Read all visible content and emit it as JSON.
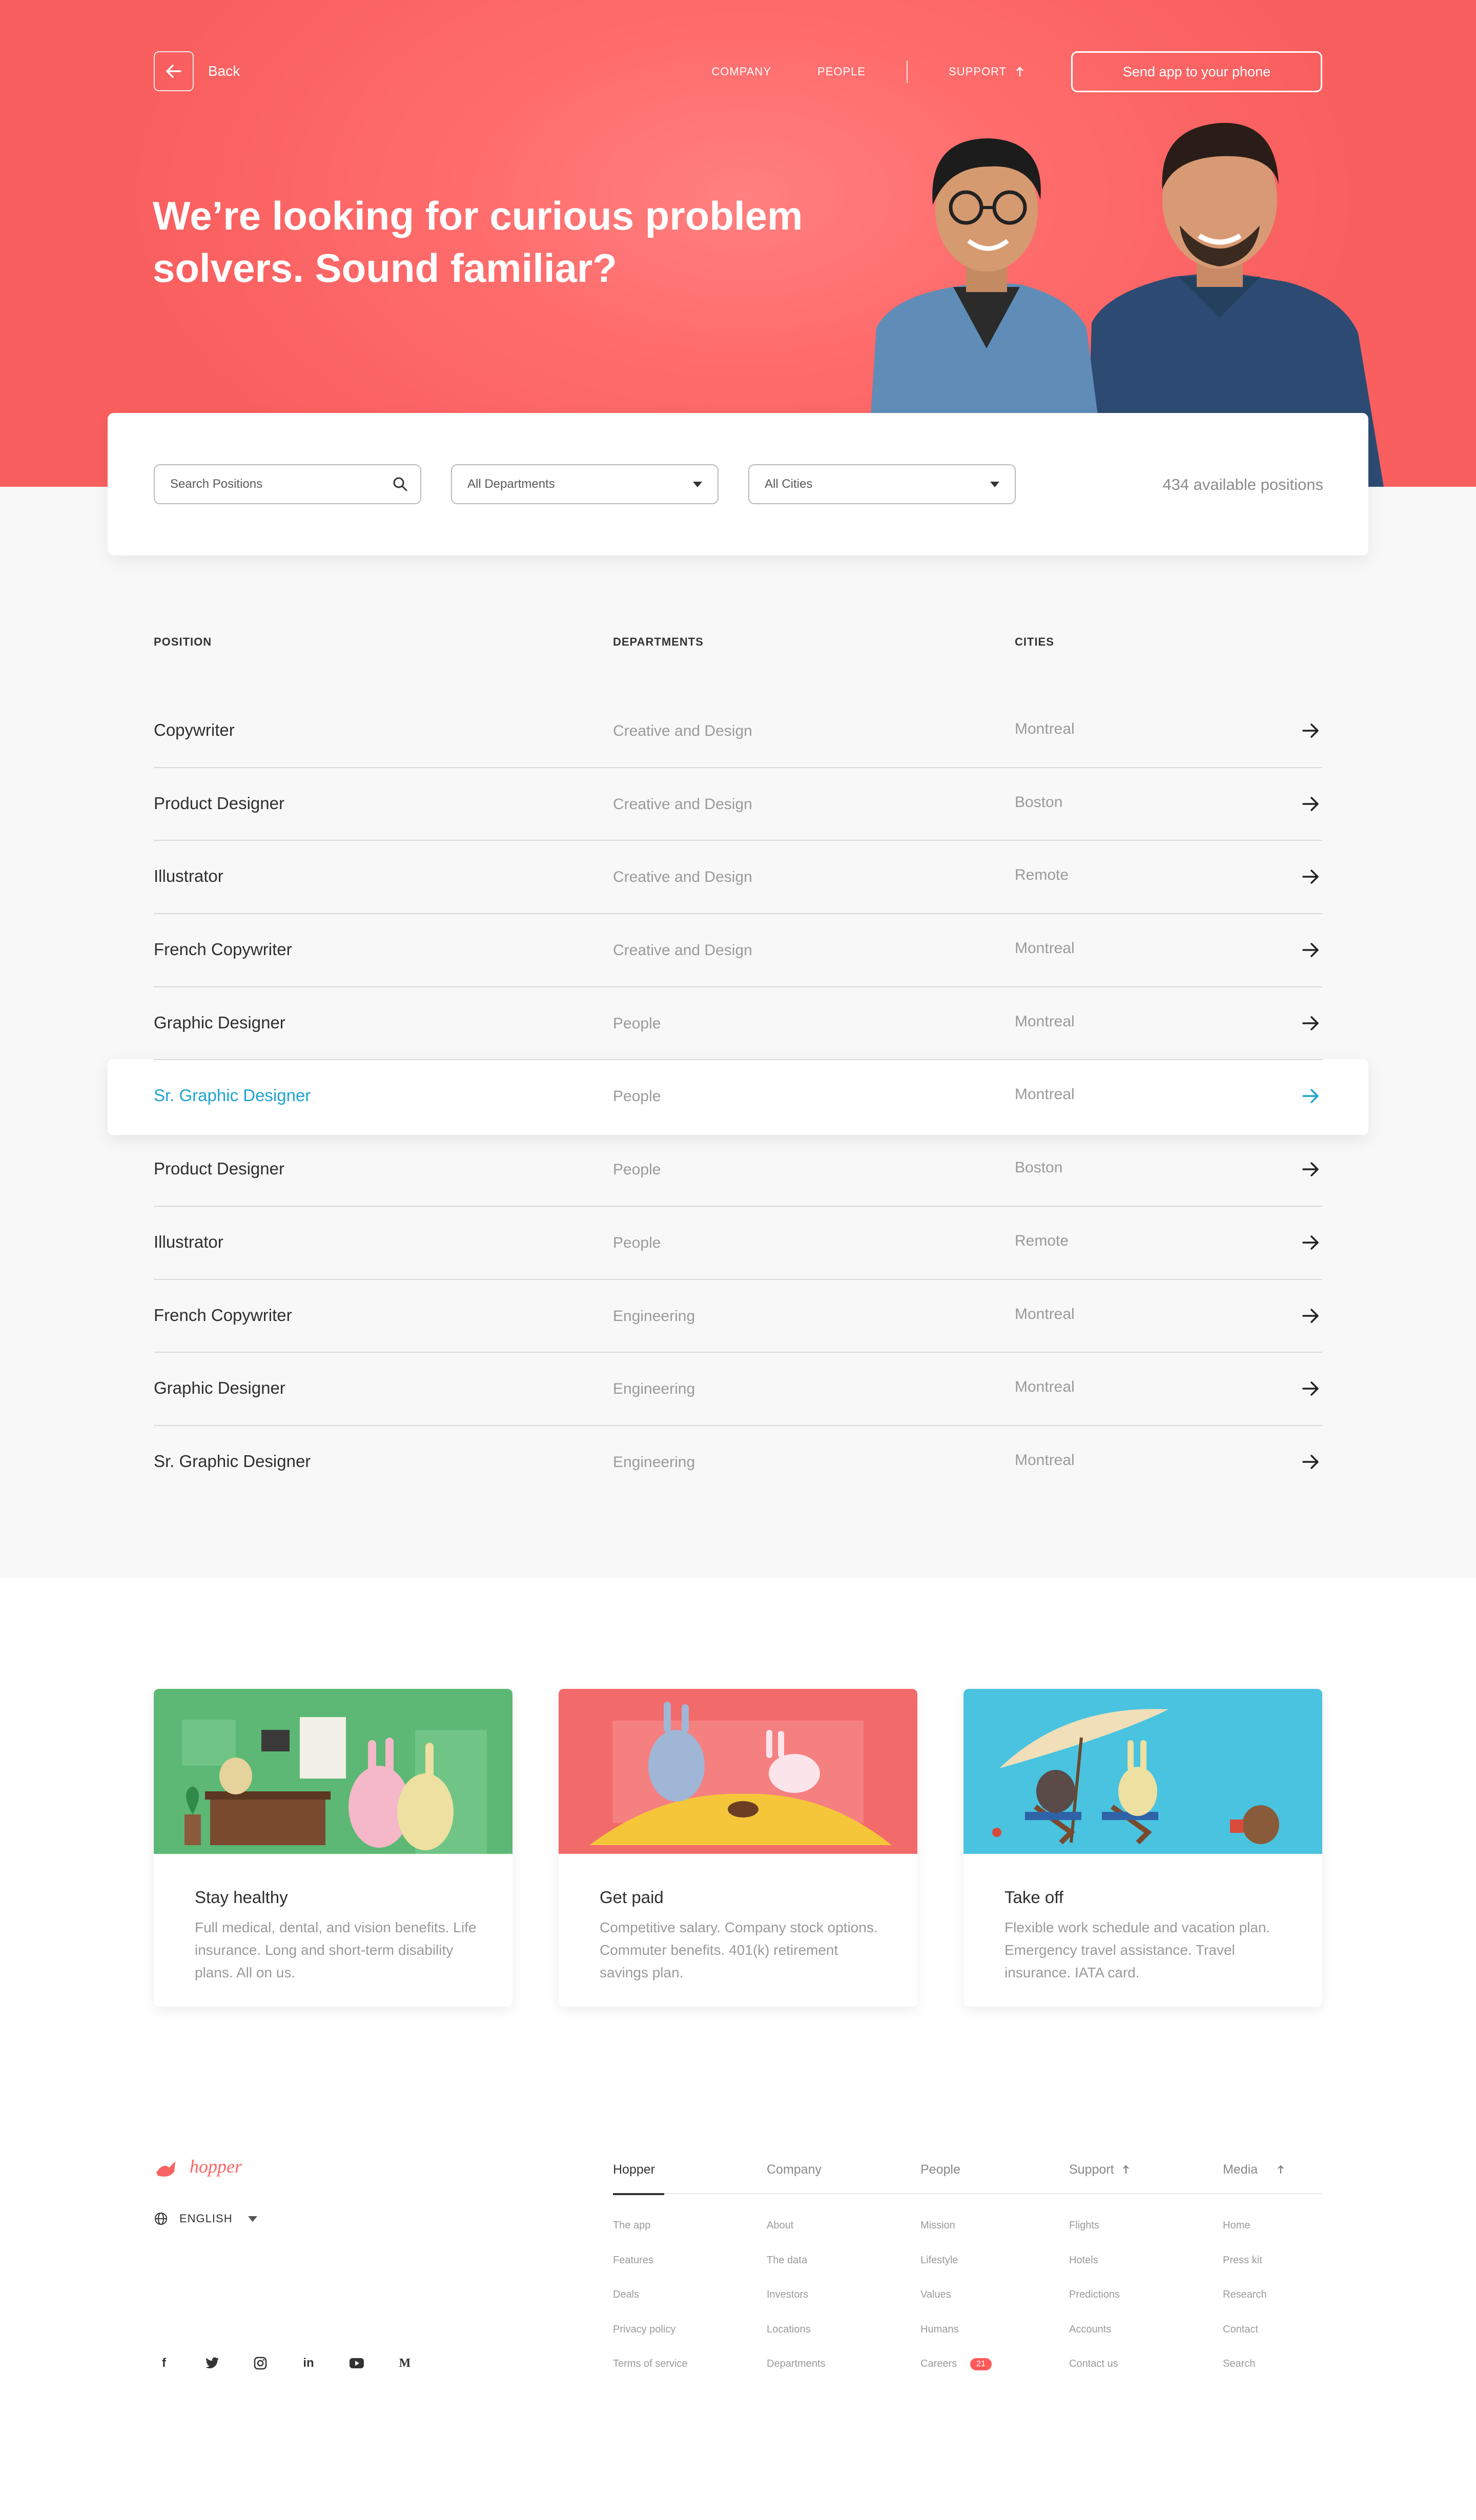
{
  "header": {
    "back_label": "Back",
    "nav": [
      "COMPANY",
      "PEOPLE",
      "SUPPORT"
    ],
    "send_button": "Send app to your phone"
  },
  "hero": {
    "title": "We’re looking for curious problem solvers. Sound familiar?"
  },
  "filters": {
    "search_placeholder": "Search Positions",
    "department_selected": "All Departments",
    "city_selected": "All Cities",
    "count": "434 available positions"
  },
  "table": {
    "headers": {
      "position": "POSITION",
      "departments": "DEPARTMENTS",
      "cities": "CITIES"
    },
    "rows": [
      {
        "position": "Copywriter",
        "department": "Creative and Design",
        "city": "Montreal"
      },
      {
        "position": "Product Designer",
        "department": "Creative and Design",
        "city": "Boston"
      },
      {
        "position": "Illustrator",
        "department": "Creative and Design",
        "city": "Remote"
      },
      {
        "position": "French Copywriter",
        "department": "Creative and Design",
        "city": "Montreal"
      },
      {
        "position": "Graphic Designer",
        "department": "People",
        "city": "Montreal"
      },
      {
        "position": "Sr. Graphic Designer",
        "department": "People",
        "city": "Montreal"
      },
      {
        "position": "Product Designer",
        "department": "People",
        "city": "Boston"
      },
      {
        "position": "Illustrator",
        "department": "People",
        "city": "Remote"
      },
      {
        "position": "French Copywriter",
        "department": "Engineering",
        "city": "Montreal"
      },
      {
        "position": "Graphic Designer",
        "department": "Engineering",
        "city": "Montreal"
      },
      {
        "position": "Sr. Graphic Designer",
        "department": "Engineering",
        "city": "Montreal"
      }
    ],
    "highlight_color": "#1fa3d1"
  },
  "benefits": [
    {
      "title": "Stay healthy",
      "desc": "Full medical, dental, and vision benefits. Life insurance. Long and short-term disability plans. All on us.",
      "color": "#5cb874"
    },
    {
      "title": "Get paid",
      "desc": "Competitive salary. Company stock options. Commuter benefits. 401(k) retirement savings plan.",
      "color": "#f26a6a"
    },
    {
      "title": "Take off",
      "desc": "Flexible work schedule and vacation plan. Emergency travel assistance. Travel insurance. IATA card.",
      "color": "#49c3e0"
    }
  ],
  "footer": {
    "logo": "hopper",
    "language": "ENGLISH",
    "socials": [
      "facebook-icon",
      "twitter-icon",
      "instagram-icon",
      "linkedin-icon",
      "youtube-icon",
      "medium-icon"
    ],
    "columns": [
      {
        "heading": "Hopper",
        "links": [
          "The app",
          "Features",
          "Deals",
          "Privacy policy",
          "Terms of service"
        ]
      },
      {
        "heading": "Company",
        "links": [
          "About",
          "The data",
          "Investors",
          "Locations",
          "Departments"
        ]
      },
      {
        "heading": "People",
        "links": [
          "Mission",
          "Lifestyle",
          "Values",
          "Humans",
          "Careers"
        ]
      },
      {
        "heading": "Support",
        "links": [
          "Flights",
          "Hotels",
          "Predictions",
          "Accounts",
          "Contact us"
        ]
      },
      {
        "heading": "Media",
        "links": [
          "Home",
          "Press kit",
          "Research",
          "Contact",
          "Search"
        ]
      }
    ],
    "careers_badge": "21"
  },
  "colors": {
    "brand": "#fa6464",
    "accent": "#1fa3d1"
  }
}
